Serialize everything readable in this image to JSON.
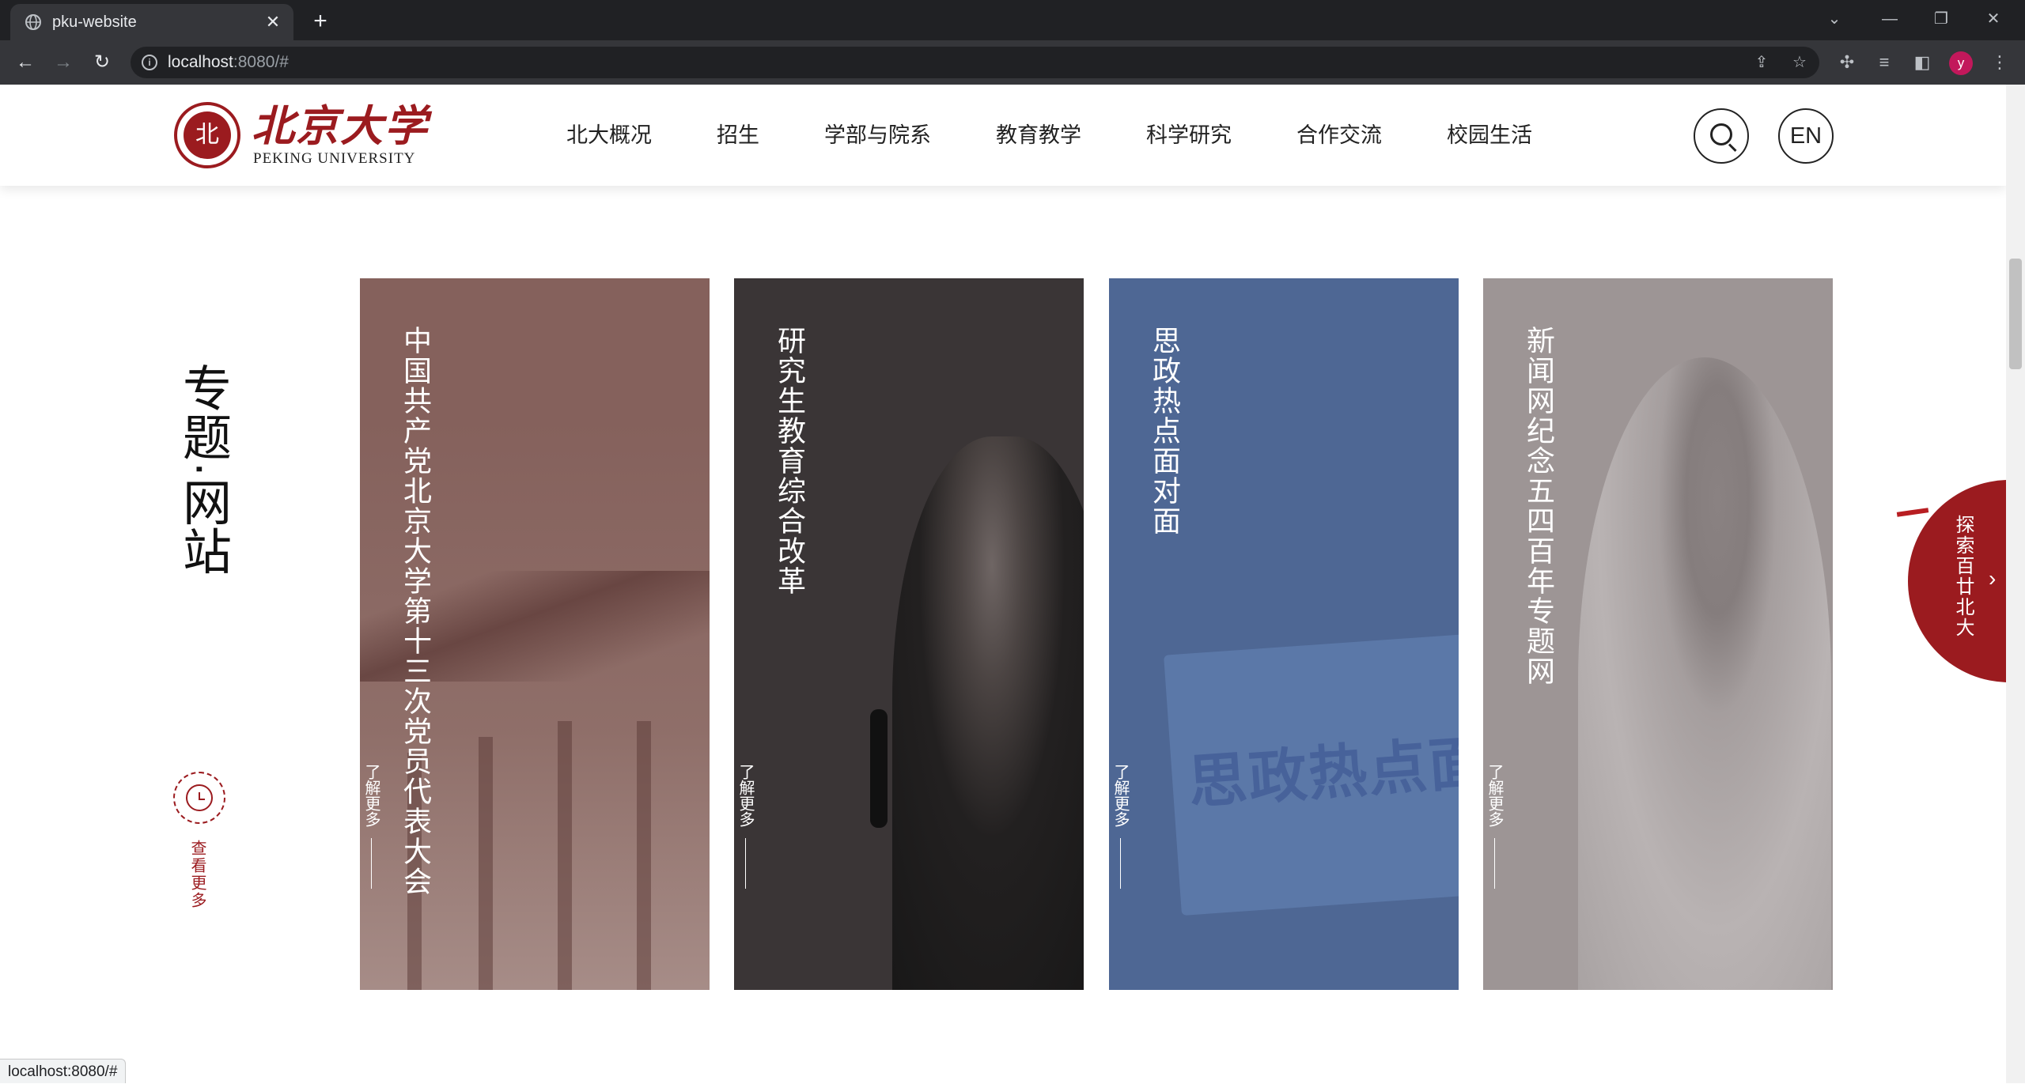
{
  "browser": {
    "tab_title": "pku-website",
    "url_host": "localhost",
    "url_rest": ":8080/#",
    "status_url": "localhost:8080/#",
    "profile_initial": "y"
  },
  "site": {
    "logo_cn": "北京大学",
    "logo_en": "PEKING UNIVERSITY",
    "nav": [
      "北大概况",
      "招生",
      "学部与院系",
      "教育教学",
      "科学研究",
      "合作交流",
      "校园生活"
    ],
    "lang_button": "EN"
  },
  "section": {
    "title": "专题·网站",
    "more_label": "查看更多"
  },
  "cards": [
    {
      "title": "中国共产党北京大学第十三次党员代表大会",
      "learn_more": "了解更多",
      "color": "#85615c"
    },
    {
      "title": "研究生教育综合改革",
      "learn_more": "了解更多",
      "color": "#3a3536"
    },
    {
      "title": "思政热点面对面",
      "learn_more": "了解更多",
      "color": "#4e6794",
      "image_text": "思政热点面对面"
    },
    {
      "title": "新闻网纪念五四百年专题网",
      "learn_more": "了解更多",
      "color": "#9d9595"
    }
  ],
  "badge": {
    "label": "探索百廿北大",
    "color": "#9b1b1f"
  },
  "colors": {
    "brand_red": "#9b1b1f",
    "chrome_dark": "#202124",
    "chrome_toolbar": "#35363a"
  }
}
